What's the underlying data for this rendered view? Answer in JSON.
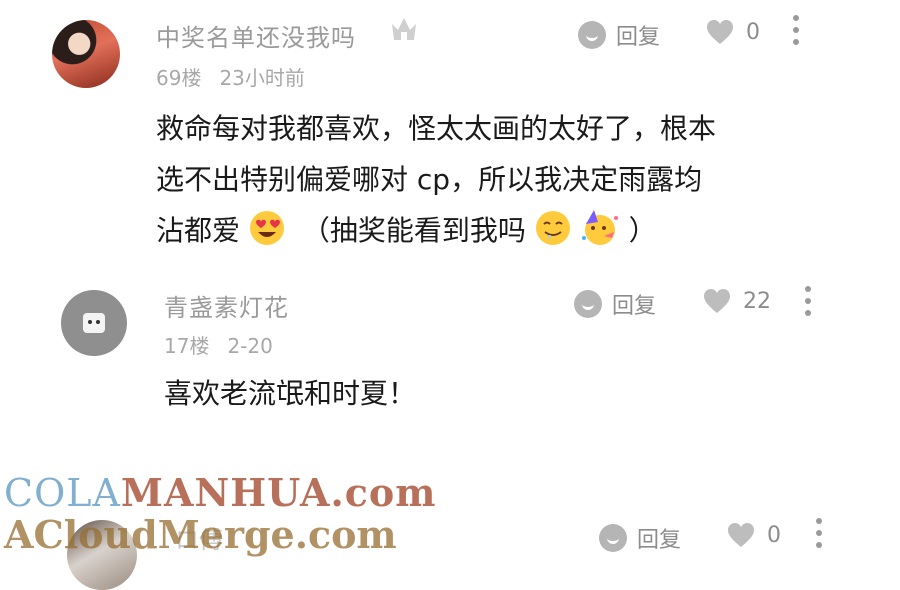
{
  "comments": [
    {
      "username": "中奖名单还没我吗",
      "floor": "69楼",
      "time": "23小时前",
      "reply_label": "回复",
      "likes": "0",
      "lines": [
        "救命每对我都喜欢，怪太太画的太好了，根本",
        "选不出特别偏爱哪对 cp，所以我决定雨露均",
        "沾都爱"
      ],
      "line3_after_emoji": "（抽奖能看到我吗",
      "line3_end": "）",
      "icons": [
        "crown-icon",
        "heart-eyes-emoji",
        "drooling-emoji",
        "party-face-emoji"
      ]
    },
    {
      "username": "青盏素灯花",
      "floor": "17楼",
      "time": "2-20",
      "reply_label": "回复",
      "likes": "22",
      "content": "喜欢老流氓和时夏！"
    },
    {
      "username": "ロ傅",
      "reply_label": "回复",
      "likes": "0"
    }
  ],
  "watermarks": {
    "line1_part1": "COLA",
    "line1_part2": "MANHUA.com",
    "line2": "ACloudMerge.com"
  },
  "colors": {
    "muted_text": "#9a9a9a",
    "icon_gray": "#b5b5b5",
    "content_text": "#1a1a1a"
  }
}
